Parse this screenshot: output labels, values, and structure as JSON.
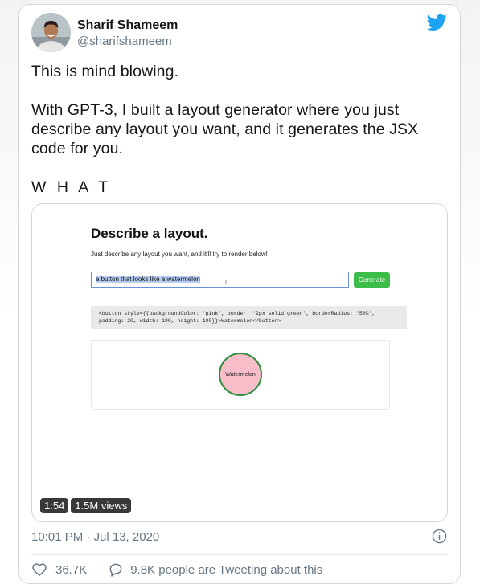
{
  "author": {
    "name": "Sharif Shameem",
    "handle": "@sharifshameem"
  },
  "tweet": {
    "line1": "This is mind blowing.",
    "line2": "With GPT-3, I built a layout generator where you just describe any layout you want, and it generates the JSX code for you.",
    "line3": "W H A T"
  },
  "video": {
    "app_title": "Describe a layout.",
    "app_subtitle": "Just describe any layout you want, and it'll try to render below!",
    "input_value": "a button that looks like a watermelon",
    "generate_label": "Generate",
    "code": "<button style={{backgroundColor: 'pink', border: '2px solid green', borderRadius: '50%', padding: 20, width: 100, height: 100}}>Watermelon</button>",
    "watermelon_label": "Watermelon",
    "duration": "1:54",
    "views": "1.5M views"
  },
  "meta": {
    "timestamp": "10:01 PM · Jul 13, 2020",
    "like_count": "36.7K",
    "tweeting_text": "9.8K people are Tweeting about this"
  },
  "colors": {
    "twitter_blue": "#1da1f2",
    "secondary_text": "#657786",
    "generate_green": "#3cbd4a",
    "watermelon_pink": "#f7bdc9",
    "watermelon_border": "#2f8f3c"
  }
}
